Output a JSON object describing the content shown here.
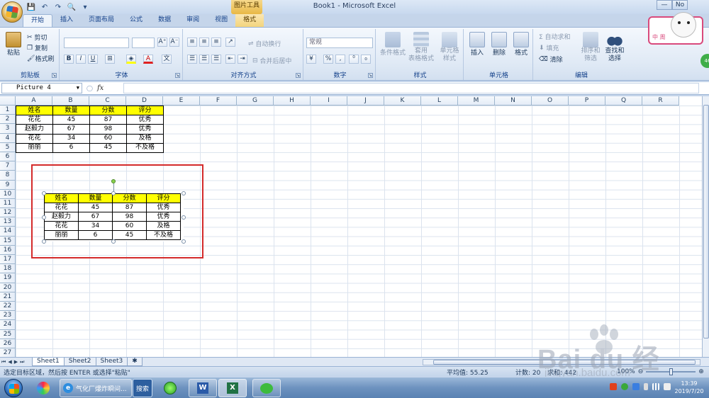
{
  "window": {
    "title": "Book1 - Microsoft Excel",
    "context_tool": "图片工具",
    "ctrl_min": "—",
    "ctrl_max": "No",
    "ctrl_close": "✕"
  },
  "qat": {
    "save": "💾",
    "undo": "↶",
    "redo": "↷",
    "print_preview": "🔍",
    "customize": "▾"
  },
  "tabs": [
    {
      "label": "开始",
      "active": true
    },
    {
      "label": "插入"
    },
    {
      "label": "页面布局"
    },
    {
      "label": "公式"
    },
    {
      "label": "数据"
    },
    {
      "label": "审阅"
    },
    {
      "label": "视图"
    },
    {
      "label": "格式",
      "context": true
    }
  ],
  "ribbon": {
    "clipboard": {
      "label": "剪贴板",
      "paste": "粘贴",
      "cut": "剪切",
      "copy": "复制",
      "format_painter": "格式刷"
    },
    "font": {
      "label": "字体",
      "grow": "A⁺",
      "shrink": "A⁻",
      "bold": "B",
      "italic": "I",
      "underline": "U",
      "border": "⊞",
      "fill": "◈",
      "color": "A",
      "wen": "文"
    },
    "alignment": {
      "label": "对齐方式",
      "wrap": "自动换行",
      "merge": "合并后居中"
    },
    "number": {
      "label": "数字",
      "format": "常规",
      "percent": "%",
      "comma": ","
    },
    "styles": {
      "label": "样式",
      "conditional": "条件格式",
      "table": "套用\n表格格式",
      "cell": "单元格\n样式"
    },
    "cells": {
      "label": "单元格",
      "insert": "插入",
      "delete": "删除",
      "format": "格式"
    },
    "editing": {
      "label": "编辑",
      "autosum": "Σ 自动求和",
      "fill": "填充",
      "clear": "清除",
      "sort": "排序和\n筛选",
      "find": "查找和\n选择"
    }
  },
  "sticker": {
    "text": "中 周"
  },
  "badge": "46",
  "formula": {
    "name_box": "Picture 4",
    "fx": "fx",
    "value": ""
  },
  "columns": [
    "A",
    "B",
    "C",
    "D",
    "E",
    "F",
    "G",
    "H",
    "I",
    "J",
    "K",
    "L",
    "M",
    "N",
    "O",
    "P",
    "Q",
    "R"
  ],
  "rows": [
    "1",
    "2",
    "3",
    "4",
    "5",
    "6",
    "7",
    "8",
    "9",
    "10",
    "11",
    "12",
    "13",
    "14",
    "15",
    "16",
    "17",
    "18",
    "19",
    "20",
    "21",
    "22",
    "23",
    "24",
    "25",
    "26",
    "27"
  ],
  "table": {
    "headers": [
      "姓名",
      "数量",
      "分数",
      "评分"
    ],
    "rows": [
      [
        "花花",
        "45",
        "87",
        "优秀"
      ],
      [
        "赵毅力",
        "67",
        "98",
        "优秀"
      ],
      [
        "花花",
        "34",
        "60",
        "及格"
      ],
      [
        "丽丽",
        "6",
        "45",
        "不及格"
      ]
    ]
  },
  "sheets": [
    {
      "label": "Sheet1",
      "active": true
    },
    {
      "label": "Sheet2"
    },
    {
      "label": "Sheet3"
    }
  ],
  "status": {
    "message": "选定目标区域，然后按 ENTER 或选择\"粘贴\"",
    "average": "平均值: 55.25",
    "count": "计数: 20",
    "sum": "求和: 442",
    "zoom": "100%"
  },
  "taskbar": {
    "browser": "气化厂爆炸瞬间...",
    "search": "搜索",
    "time": "13:39",
    "date": "2019/7/20"
  },
  "watermark": {
    "text": "Bai du 经验",
    "url": "jingyan.baidu.com"
  }
}
